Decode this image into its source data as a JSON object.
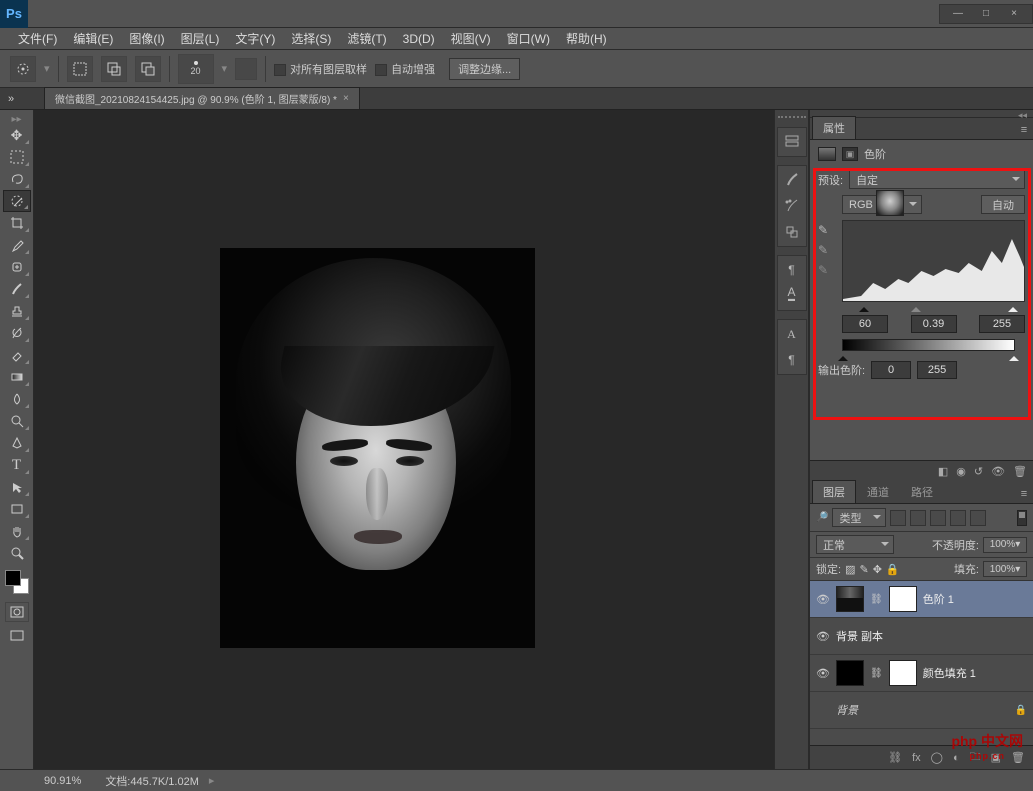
{
  "app": {
    "logo_text": "Ps"
  },
  "window_controls": {
    "min": "—",
    "max": "□",
    "close": "×"
  },
  "menubar": [
    "文件(F)",
    "编辑(E)",
    "图像(I)",
    "图层(L)",
    "文字(Y)",
    "选择(S)",
    "滤镜(T)",
    "3D(D)",
    "视图(V)",
    "窗口(W)",
    "帮助(H)"
  ],
  "options": {
    "brush_size": "20",
    "sample_all": "对所有图层取样",
    "auto_enhance": "自动增强",
    "refine_edge": "调整边缘..."
  },
  "document_tab": {
    "title": "微信截图_20210824154425.jpg @ 90.9% (色阶 1, 图层蒙版/8) *",
    "close": "×"
  },
  "tools": [
    "move",
    "marquee",
    "lasso",
    "quick-select",
    "crop",
    "eyedrop",
    "patch",
    "brush",
    "stamp",
    "history",
    "eraser",
    "gradient",
    "blur",
    "dodge",
    "pen",
    "type",
    "path",
    "rect",
    "hand",
    "zoom"
  ],
  "properties": {
    "panel_title": "属性",
    "adj_name": "色阶",
    "preset_label": "预设:",
    "preset_value": "自定",
    "channel_value": "RGB",
    "auto_btn": "自动",
    "input_levels": {
      "black": "60",
      "gamma": "0.39",
      "white": "255"
    },
    "output_label": "输出色阶:",
    "output": {
      "black": "0",
      "white": "255"
    }
  },
  "layers": {
    "tab_layers": "图层",
    "tab_channels": "通道",
    "tab_paths": "路径",
    "filter_kind": "类型",
    "blend_mode": "正常",
    "opacity_label": "不透明度:",
    "opacity_value": "100%",
    "lock_label": "锁定:",
    "fill_label": "填充:",
    "fill_value": "100%",
    "items": [
      {
        "name": "色阶 1",
        "selected": true,
        "type": "adj-levels",
        "visible": true
      },
      {
        "name": "背景 副本",
        "selected": false,
        "type": "pixel",
        "visible": true
      },
      {
        "name": "颜色填充 1",
        "selected": false,
        "type": "adj-solid",
        "visible": true
      },
      {
        "name": "背景",
        "selected": false,
        "type": "bg",
        "visible": false,
        "locked": true
      }
    ]
  },
  "status": {
    "zoom": "90.91%",
    "docinfo": "文档:445.7K/1.02M"
  },
  "watermark": {
    "main": "php 中文网",
    "sub": "php.cn"
  }
}
